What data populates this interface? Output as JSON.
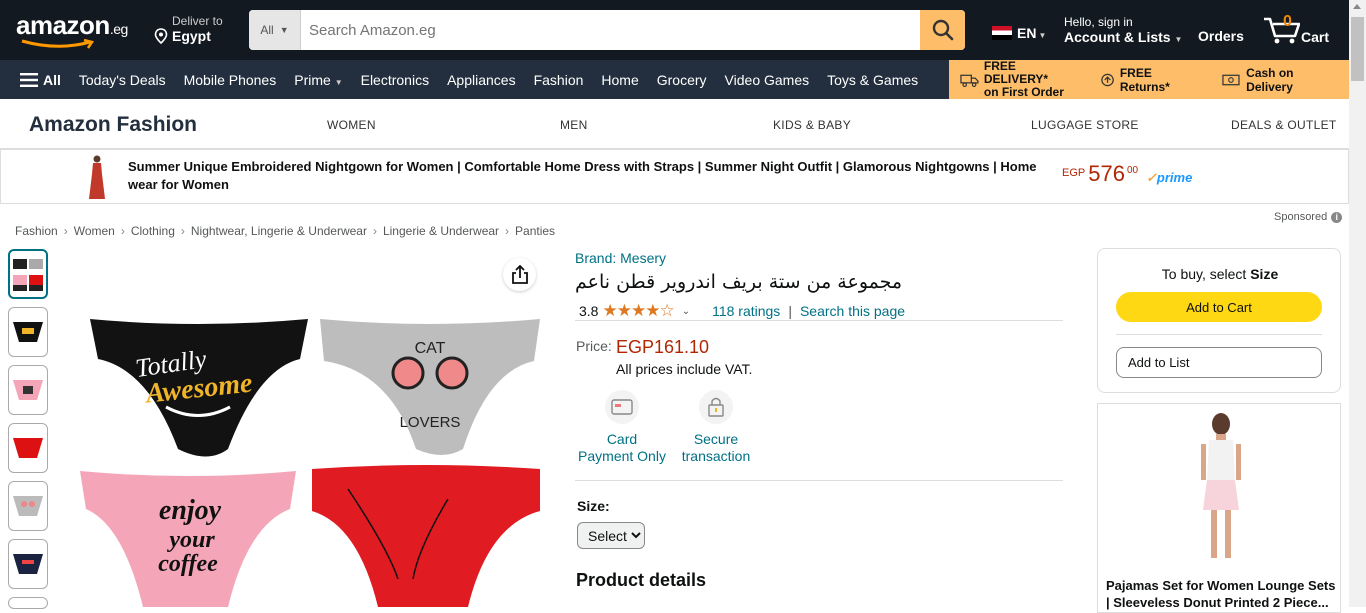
{
  "header": {
    "logo_text": "amazon",
    "logo_suffix": ".eg",
    "deliver_line1": "Deliver to",
    "deliver_line2": "Egypt",
    "search_category": "All",
    "search_placeholder": "Search Amazon.eg",
    "language": "EN",
    "account_line1": "Hello, sign in",
    "account_line2": "Account & Lists",
    "orders": "Orders",
    "cart_count": "0",
    "cart_label": "Cart"
  },
  "subnav": {
    "all": "All",
    "items": [
      "Today's Deals",
      "Mobile Phones",
      "Prime",
      "Electronics",
      "Appliances",
      "Fashion",
      "Home",
      "Grocery",
      "Video Games",
      "Toys & Games"
    ]
  },
  "promo": {
    "delivery_line1": "FREE DELIVERY*",
    "delivery_line2": "on First Order",
    "returns": "FREE Returns*",
    "cod": "Cash on Delivery"
  },
  "fashion": {
    "title": "Amazon Fashion",
    "categories": [
      "WOMEN",
      "MEN",
      "KIDS & BABY",
      "LUGGAGE STORE",
      "DEALS & OUTLET"
    ]
  },
  "banner": {
    "text": "Summer Unique Embroidered Nightgown for Women | Comfortable Home Dress with Straps | Summer Night Outfit | Glamorous Nightgowns | Home wear for Women",
    "currency": "EGP",
    "price_whole": "576",
    "price_fraction": "00",
    "prime": "prime"
  },
  "sponsored": "Sponsored",
  "breadcrumb": [
    "Fashion",
    "Women",
    "Clothing",
    "Nightwear, Lingerie & Underwear",
    "Lingerie & Underwear",
    "Panties"
  ],
  "product": {
    "brand": "Brand: Mesery",
    "title": "مجموعة من ستة بريف اندروير قطن ناعم",
    "rating": "3.8",
    "stars_filled": 4,
    "ratings_count": "118 ratings",
    "search_page": "Search this page",
    "price_label": "Price:",
    "price": "EGP161.10",
    "vat_note": "All prices include VAT.",
    "feature1_line1": "Card",
    "feature1_line2": "Payment Only",
    "feature2_line1": "Secure",
    "feature2_line2": "transaction",
    "size_label": "Size:",
    "size_value": "Select",
    "details_title": "Product details",
    "image_texts": {
      "q1_line1": "Totally",
      "q1_line2": "Awesome",
      "q2_line1": "CAT",
      "q2_line2": "LOVERS",
      "q3_line1": "enjoy",
      "q3_line2": "your",
      "q3_line3": "coffee"
    }
  },
  "buybox": {
    "note_prefix": "To buy, select ",
    "note_bold": "Size",
    "add_to_cart": "Add to Cart",
    "add_to_list": "Add to List"
  },
  "ad": {
    "title": "Pajamas Set for Women Lounge Sets | Sleeveless Donut Printed 2 Piece..."
  },
  "colors": {
    "nav_dark": "#131921",
    "nav_secondary": "#232f3e",
    "promo_bg": "#febd69",
    "link": "#007185",
    "price": "#b12704",
    "add_to_cart": "#ffd814"
  }
}
